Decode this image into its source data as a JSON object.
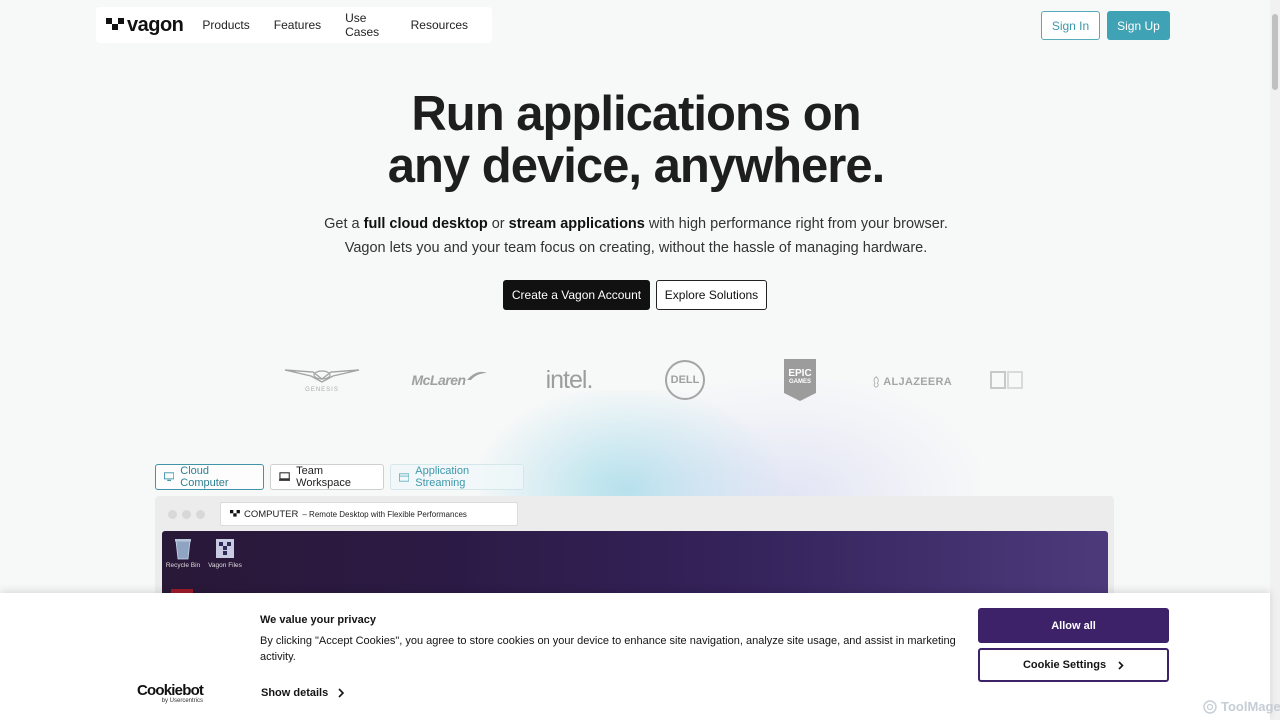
{
  "nav": {
    "logo_text": "vagon",
    "links": [
      "Products",
      "Features",
      "Use Cases",
      "Resources"
    ],
    "sign_in": "Sign In",
    "sign_up": "Sign Up"
  },
  "hero": {
    "title_line1": "Run applications on",
    "title_line2": "any device, anywhere.",
    "sub_prefix": "Get a ",
    "sub_bold1": "full cloud desktop",
    "sub_mid": " or ",
    "sub_bold2": "stream applications",
    "sub_suffix": " with high performance right from your browser.",
    "sub_line2": "Vagon lets you and your team focus on creating, without the hassle of managing hardware.",
    "cta_primary": "Create a Vagon Account",
    "cta_secondary": "Explore Solutions"
  },
  "logos": {
    "genesis": "GENESIS",
    "mclaren": "McLaren",
    "intel": "intel.",
    "dell": "DELL",
    "epic_line1": "EPIC",
    "epic_line2": "GAMES",
    "aljazeera": "ALJAZEERA"
  },
  "tabs": [
    "Cloud Computer",
    "Team Workspace",
    "Application Streaming"
  ],
  "preview": {
    "url_strong": "COMPUTER",
    "url_rest": " – Remote Desktop with Flexible Performances",
    "icons": [
      "Recycle Bin",
      "Vagon Files"
    ]
  },
  "cookie": {
    "title": "We value your privacy",
    "text": "By clicking \"Accept Cookies\", you agree to store cookies on your device to enhance site navigation, analyze site usage, and assist in marketing activity.",
    "show_details": "Show details",
    "brand": "Cookiebot",
    "brand_sub": "by Usercentrics",
    "allow_all": "Allow all",
    "settings": "Cookie Settings"
  },
  "watermark": "ToolMage",
  "colors": {
    "accent": "#3fa3b5",
    "cookie_primary": "#3d2269",
    "dark_button": "#111111"
  }
}
